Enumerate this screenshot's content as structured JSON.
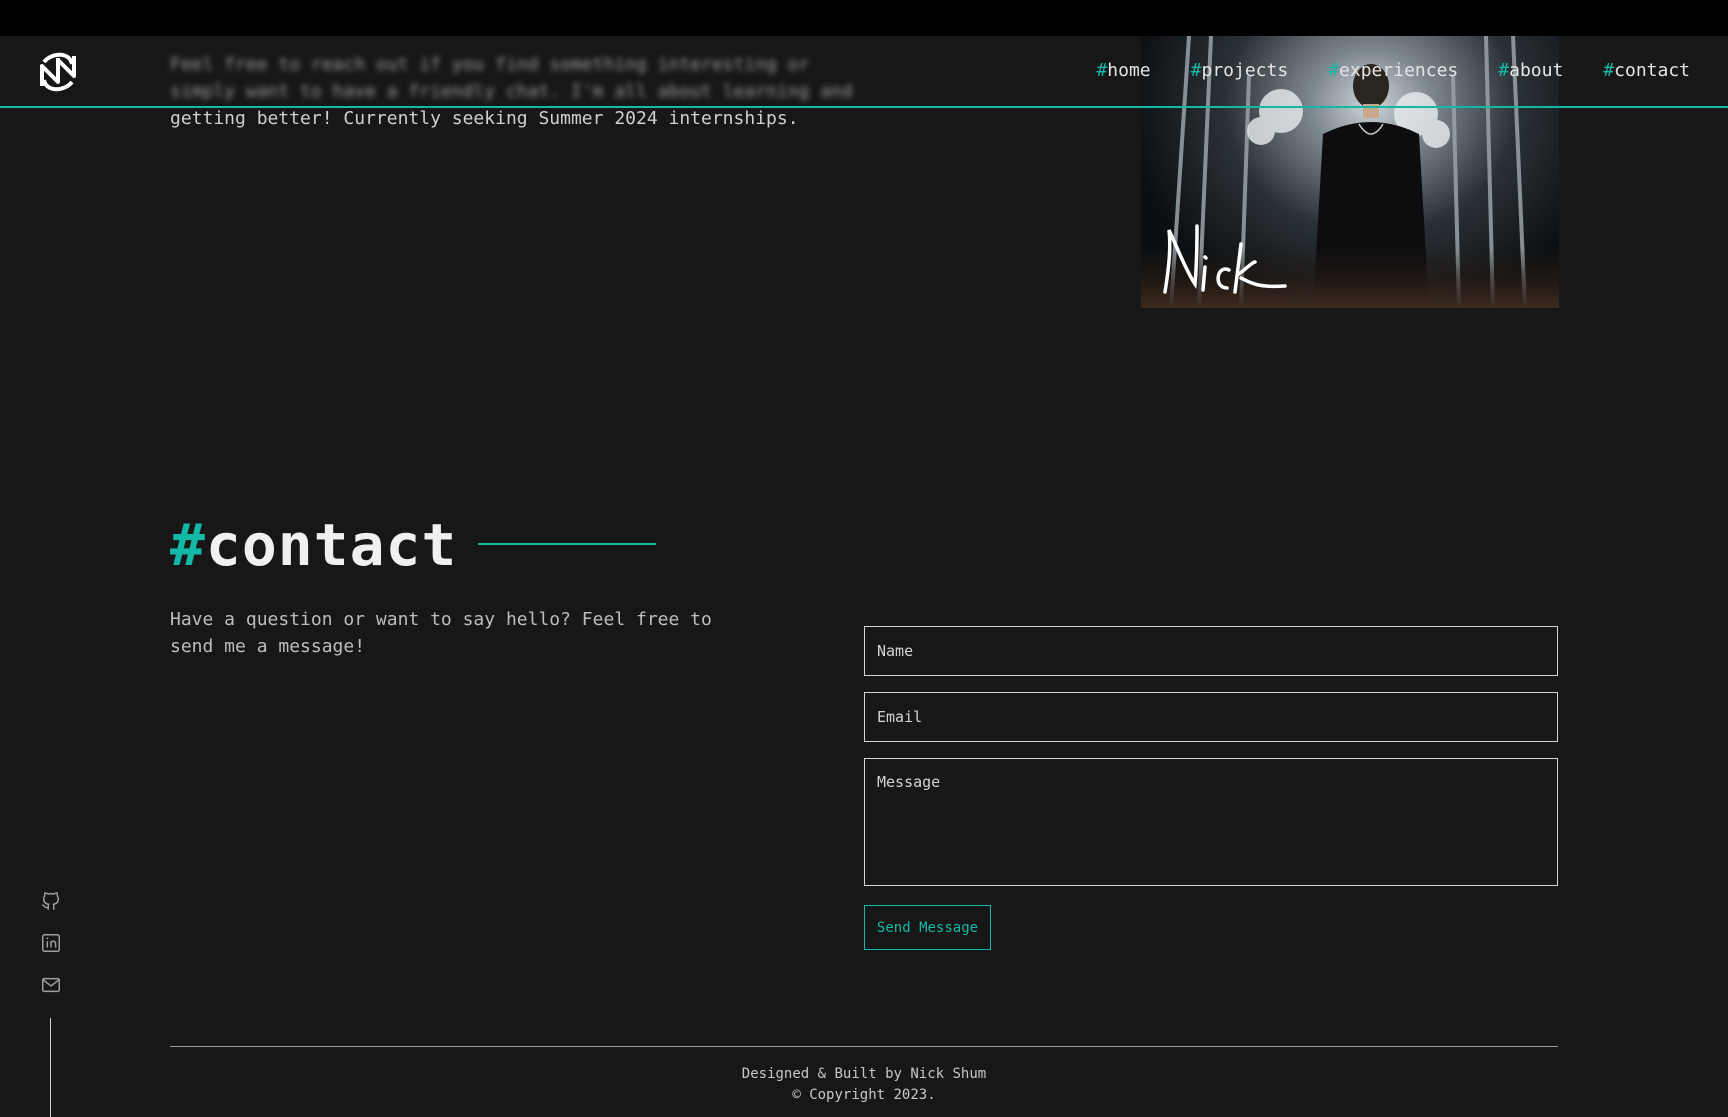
{
  "nav": {
    "hash": "#",
    "items": [
      {
        "label": "home"
      },
      {
        "label": "projects"
      },
      {
        "label": "experiences"
      },
      {
        "label": "about"
      },
      {
        "label": "contact"
      }
    ]
  },
  "intro": {
    "line1": "Feel free to reach out if you find something interesting or",
    "line2": "simply want to have a friendly chat. I'm all about learning and",
    "line3": "getting better! Currently seeking Summer 2024 internships."
  },
  "photo": {
    "signature": "Nick"
  },
  "contact": {
    "hash": "#",
    "title": "contact",
    "description": "Have a question or want to say hello? Feel free to send me a message!",
    "form": {
      "name_placeholder": "Name",
      "email_placeholder": "Email",
      "message_placeholder": "Message",
      "send_label": "Send Message"
    }
  },
  "social": {
    "icons": [
      "github-icon",
      "linkedin-icon",
      "mail-icon"
    ]
  },
  "footer": {
    "line1": "Designed & Built by Nick Shum",
    "line2": "© Copyright 2023."
  },
  "colors": {
    "accent": "#14b8a6",
    "background": "#171717",
    "topbar": "#000000"
  }
}
